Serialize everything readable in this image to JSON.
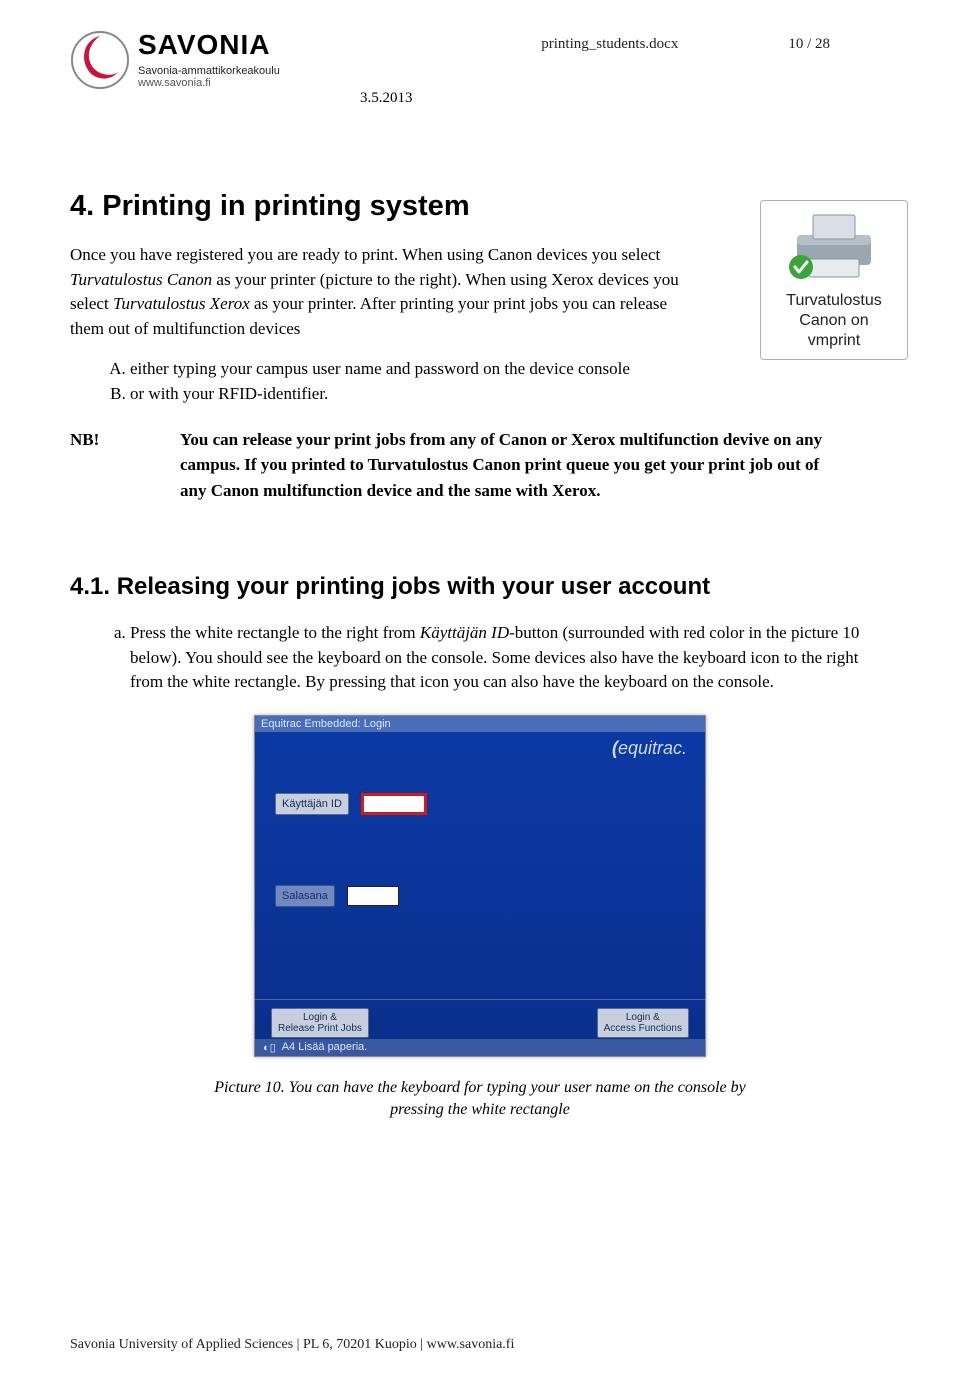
{
  "header": {
    "brand_word": "SAVONIA",
    "brand_sub": "Savonia-ammattikorkeakoulu",
    "brand_url": "www.savonia.fi",
    "doc_name": "printing_students.docx",
    "page_num": "10 / 28",
    "date": "3.5.2013"
  },
  "printer_card": {
    "line1": "Turvatulostus",
    "line2": "Canon on",
    "line3": "vmprint"
  },
  "h1": "4. Printing in printing system",
  "intro_pre": "Once you have registered you are ready to print. When using Canon devices you select ",
  "intro_em1": "Turvatulostus Canon",
  "intro_mid1": " as your printer (picture to the right). When using Xerox devices you select ",
  "intro_em2": "Turvatulostus Xerox",
  "intro_mid2": " as your printer. After printing your print jobs you can release them out of multifunction devices",
  "list_upper": {
    "a": "either typing your campus user name and password on the device console",
    "b": "or with your RFID-identifier."
  },
  "nb_label": "NB!",
  "nb_text": "You can release your print jobs from any of Canon or Xerox multifunction devive on any campus. If you printed to Turvatulostus Canon print queue you get your print job out of any Canon multifunction device and the same with Xerox.",
  "h2": "4.1. Releasing your printing jobs with your user account",
  "step_a_pre": "Press the white rectangle to the right from ",
  "step_a_em": "Käyttäjän ID",
  "step_a_post": "-button (surrounded with red color in the picture 10 below). You should see the keyboard on the console. Some devices also have the keyboard icon to the right from the white rectangle. By pressing that icon you can also have the keyboard on the console.",
  "device": {
    "title": "Equitrac Embedded: Login",
    "brand": "equitrac.",
    "id_label": "Käyttäjän ID",
    "pw_label": "Salasana",
    "btn_left": "Login &\nRelease Print Jobs",
    "btn_right": "Login &\nAccess Functions",
    "status": "A4  Lisää paperia."
  },
  "caption": "Picture 10. You can have the keyboard for typing your user name on the console by pressing the white rectangle",
  "footer": "Savonia University of Applied Sciences | PL 6, 70201 Kuopio | www.savonia.fi"
}
